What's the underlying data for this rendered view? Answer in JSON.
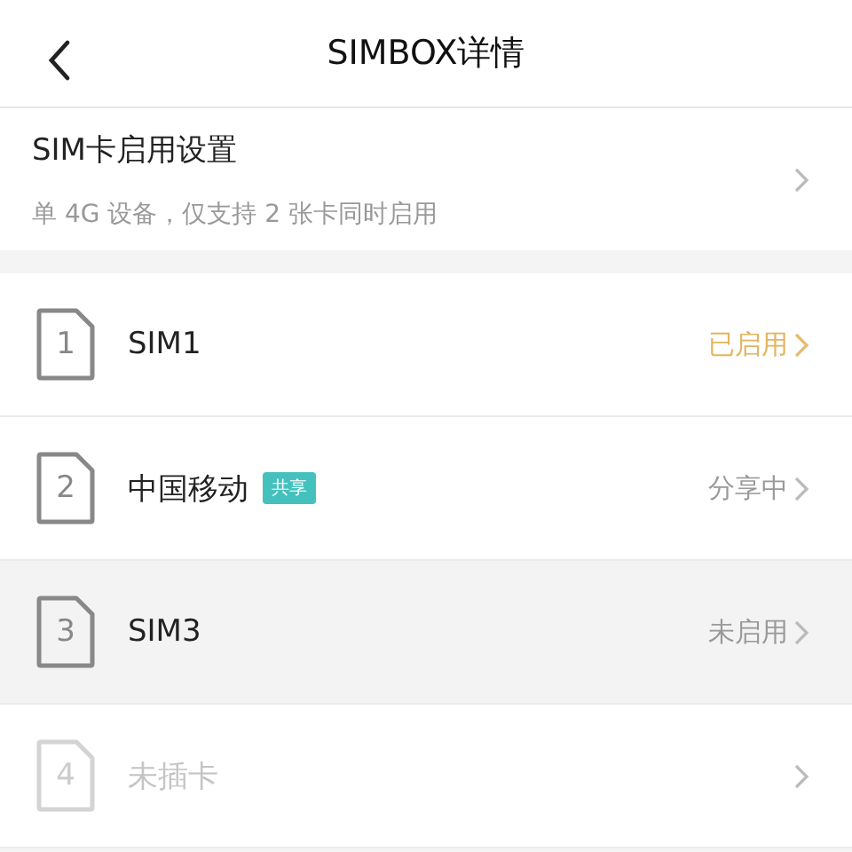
{
  "nav": {
    "title": "SIMBOX详情"
  },
  "setting": {
    "title": "SIM卡启用设置",
    "subtitle": "单 4G 设备，仅支持 2 张卡同时启用"
  },
  "slots": [
    {
      "number": "1",
      "name": "SIM1",
      "status": "已启用",
      "enabled": true,
      "inserted": true,
      "selected": false
    },
    {
      "number": "2",
      "name": "中国移动",
      "badge": "共享",
      "status": "分享中",
      "enabled": false,
      "inserted": true,
      "selected": false
    },
    {
      "number": "3",
      "name": "SIM3",
      "status": "未启用",
      "enabled": false,
      "inserted": true,
      "selected": true
    },
    {
      "number": "4",
      "name": "未插卡",
      "enabled": false,
      "inserted": false,
      "selected": false
    }
  ]
}
